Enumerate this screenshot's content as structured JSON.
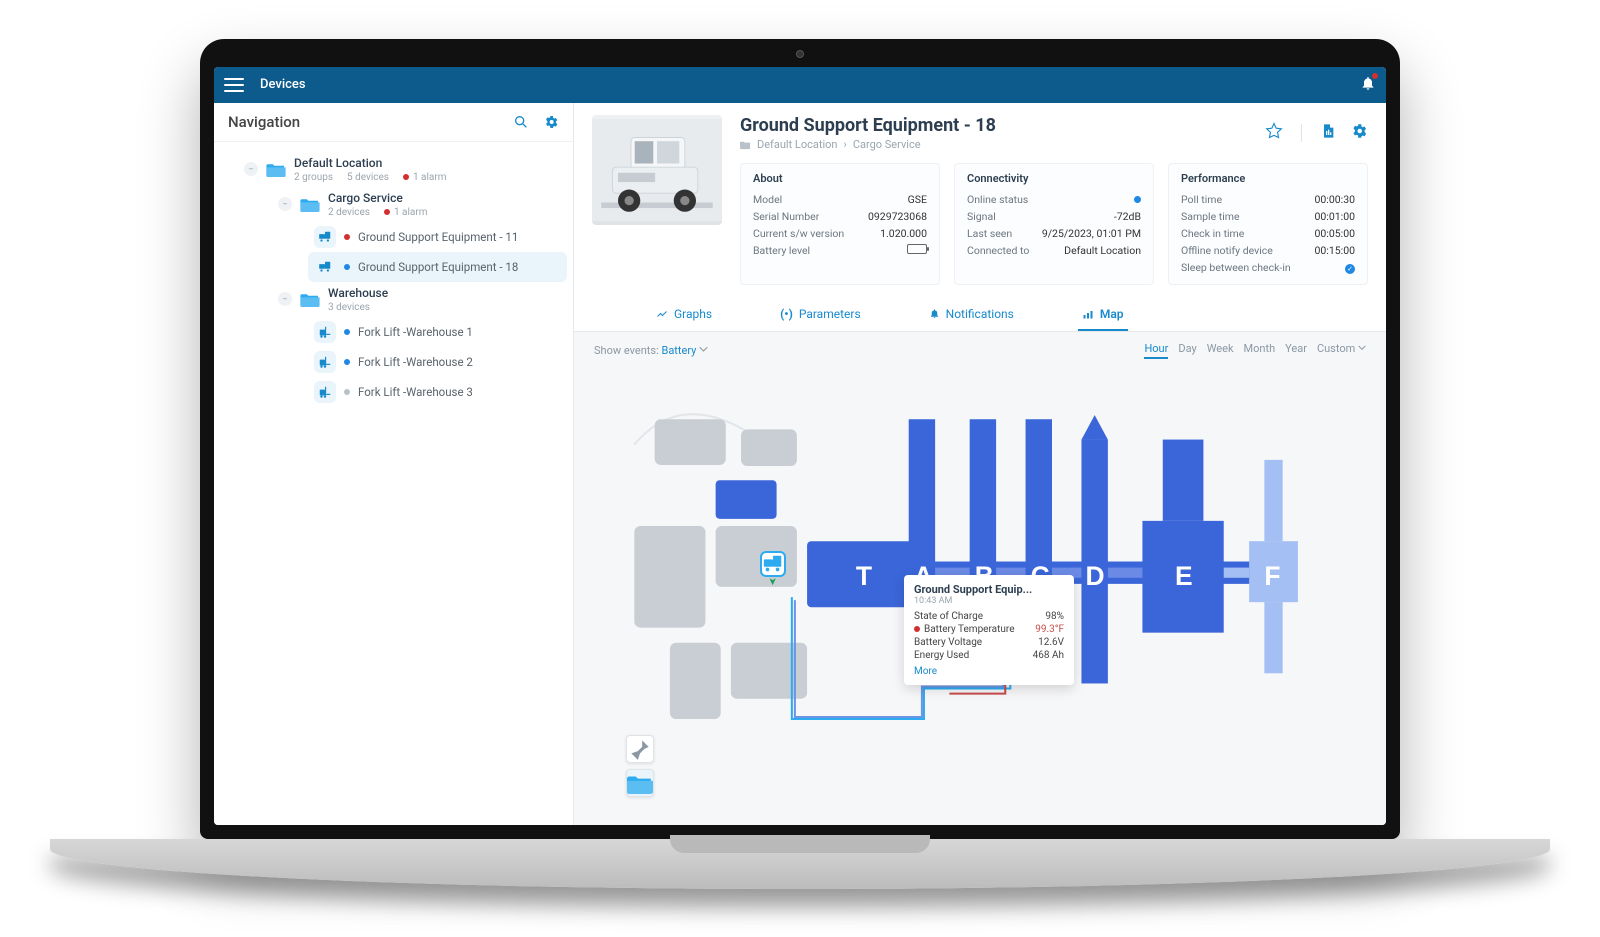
{
  "header": {
    "title": "Devices"
  },
  "sidebar": {
    "title": "Navigation",
    "nodes": {
      "root": {
        "label": "Default Location",
        "meta_groups": "2 groups",
        "meta_devices": "5 devices",
        "meta_alarm": "1 alarm"
      },
      "cargo": {
        "label": "Cargo Service",
        "meta_devices": "2 devices",
        "meta_alarm": "1 alarm"
      },
      "gse11": {
        "label": "Ground Support Equipment - 11"
      },
      "gse18": {
        "label": "Ground Support Equipment - 18"
      },
      "warehouse": {
        "label": "Warehouse",
        "meta_devices": "3 devices"
      },
      "fl1": {
        "label": "Fork Lift -Warehouse 1"
      },
      "fl2": {
        "label": "Fork Lift -Warehouse 2"
      },
      "fl3": {
        "label": "Fork Lift -Warehouse 3"
      }
    }
  },
  "detail": {
    "title": "Ground Support Equipment - 18",
    "breadcrumb": {
      "a": "Default Location",
      "b": "Cargo Service"
    },
    "about": {
      "heading": "About",
      "model_k": "Model",
      "model_v": "GSE",
      "serial_k": "Serial Number",
      "serial_v": "0929723068",
      "swver_k": "Current s/w version",
      "swver_v": "1.020.000",
      "batt_k": "Battery level"
    },
    "connectivity": {
      "heading": "Connectivity",
      "online_k": "Online status",
      "signal_k": "Signal",
      "signal_v": "-72dB",
      "lastseen_k": "Last seen",
      "lastseen_v": "9/25/2023, 01:01 PM",
      "conn_k": "Connected to",
      "conn_v": "Default Location"
    },
    "performance": {
      "heading": "Performance",
      "poll_k": "Poll time",
      "poll_v": "00:00:30",
      "sample_k": "Sample time",
      "sample_v": "00:01:00",
      "checkin_k": "Check in time",
      "checkin_v": "00:05:00",
      "offline_k": "Offline notify device",
      "offline_v": "00:15:00",
      "sleep_k": "Sleep between check-in"
    },
    "tabs": {
      "graphs": "Graphs",
      "parameters": "Parameters",
      "notifications": "Notifications",
      "map": "Map"
    }
  },
  "map": {
    "show_events_label": "Show events:",
    "show_events_value": "Battery",
    "range": {
      "hour": "Hour",
      "day": "Day",
      "week": "Week",
      "month": "Month",
      "year": "Year",
      "custom": "Custom"
    },
    "gates": {
      "t": "T",
      "a": "A",
      "b": "B",
      "c": "C",
      "d": "D",
      "e": "E",
      "f": "F"
    },
    "tooltip": {
      "title": "Ground Support Equip...",
      "time": "10:43 AM",
      "soc_k": "State of Charge",
      "soc_v": "98%",
      "temp_k": "Battery Temperature",
      "temp_v": "99.3°F",
      "volt_k": "Battery Voltage",
      "volt_v": "12.6V",
      "energy_k": "Energy Used",
      "energy_v": "468 Ah",
      "more": "More"
    }
  }
}
